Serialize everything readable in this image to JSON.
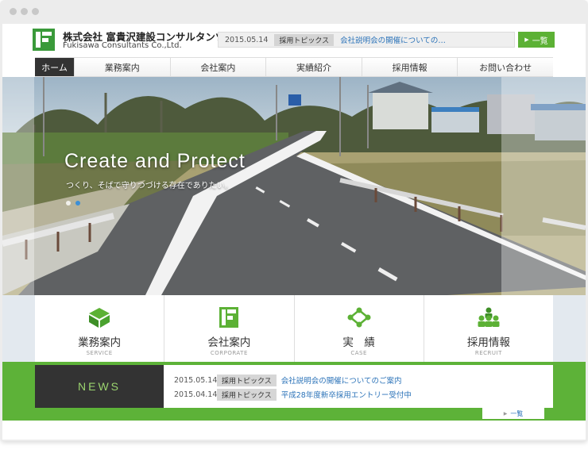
{
  "company": {
    "name_jp": "株式会社 富貴沢建設コンサルタンツ",
    "name_en": "Fukisawa Consultants Co.,Ltd."
  },
  "topics": {
    "date": "2015.05.14",
    "tag": "採用トピックス",
    "title": "会社説明会の開催についての…",
    "list_button": "一覧"
  },
  "nav": {
    "items": [
      "ホーム",
      "業務案内",
      "会社案内",
      "実績紹介",
      "採用情報",
      "お問い合わせ"
    ]
  },
  "hero": {
    "title": "Create and Protect",
    "subtitle": "つくり、そばで守りつづける存在でありたい。",
    "slide_count": 2,
    "active_slide": 2
  },
  "categories": [
    {
      "label": "業務案内",
      "sub": "SERVICE",
      "icon": "box-icon"
    },
    {
      "label": "会社案内",
      "sub": "CORPORATE",
      "icon": "company-logo-icon"
    },
    {
      "label": "実　績",
      "sub": "CASE",
      "icon": "network-icon"
    },
    {
      "label": "採用情報",
      "sub": "RECRUIT",
      "icon": "people-icon"
    }
  ],
  "news": {
    "heading": "NEWS",
    "items": [
      {
        "date": "2015.05.14",
        "tag": "採用トピックス",
        "title": "会社説明会の開催についてのご案内"
      },
      {
        "date": "2015.04.14",
        "tag": "採用トピックス",
        "title": "平成28年度新卒採用エントリー受付中"
      }
    ],
    "list_button": "一覧"
  },
  "colors": {
    "brand_green": "#5cb135",
    "nav_active": "#333333",
    "link_blue": "#2a72b8"
  }
}
